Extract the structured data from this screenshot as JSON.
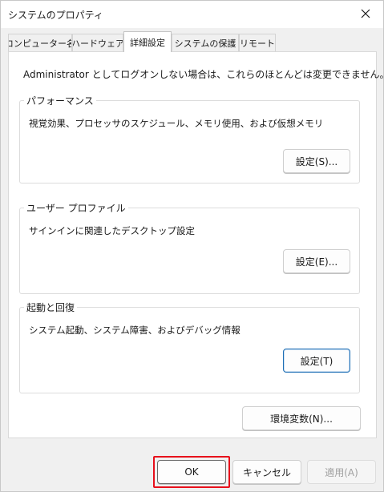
{
  "window": {
    "title": "システムのプロパティ",
    "close_icon": "close-icon"
  },
  "tabs": [
    {
      "label": "コンピューター名",
      "active": false
    },
    {
      "label": "ハードウェア",
      "active": false
    },
    {
      "label": "詳細設定",
      "active": true
    },
    {
      "label": "システムの保護",
      "active": false
    },
    {
      "label": "リモート",
      "active": false
    }
  ],
  "panel": {
    "admin_note": "Administrator としてログオンしない場合は、これらのほとんどは変更できません。",
    "performance": {
      "label": "パフォーマンス",
      "description": "視覚効果、プロセッサのスケジュール、メモリ使用、および仮想メモリ",
      "button": "設定(S)..."
    },
    "user_profile": {
      "label": "ユーザー プロファイル",
      "description": "サインインに関連したデスクトップ設定",
      "button": "設定(E)..."
    },
    "startup_recovery": {
      "label": "起動と回復",
      "description": "システム起動、システム障害、およびデバッグ情報",
      "button": "設定(T)"
    },
    "env_vars_button": "環境変数(N)..."
  },
  "footer": {
    "ok": "OK",
    "cancel": "キャンセル",
    "apply": "適用(A)"
  },
  "colors": {
    "highlight": "#e8101c",
    "focus_border": "#1f6fb5",
    "window_bg": "#f0f0f0"
  }
}
